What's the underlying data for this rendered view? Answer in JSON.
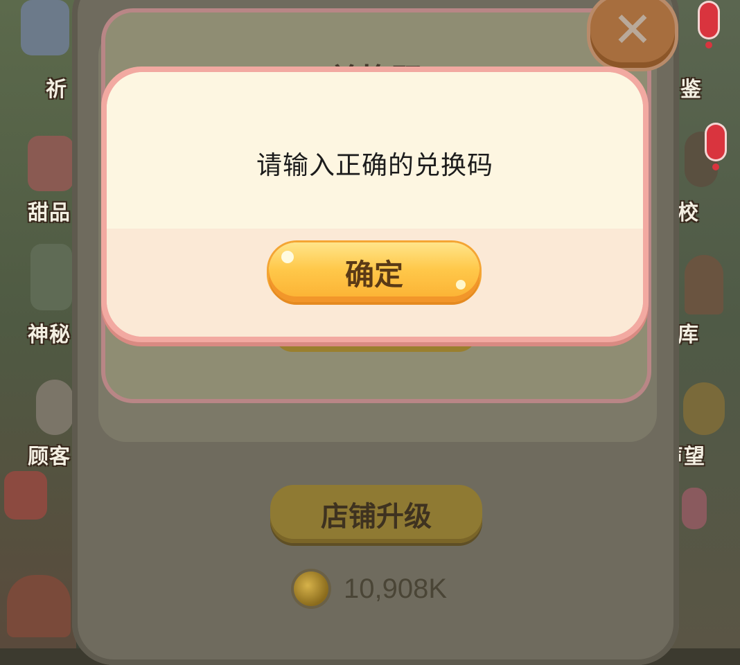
{
  "background": {
    "side_labels_left": [
      "祈",
      "甜品",
      "神秘",
      "顾客"
    ],
    "side_labels_right": [
      "鉴",
      "校",
      "库",
      "声望"
    ]
  },
  "redeem_panel": {
    "title": "兑换码",
    "close_icon": "close-x-icon"
  },
  "shop": {
    "upgrade_label": "店铺升级",
    "coin_icon": "gold-coin-icon",
    "coin_value": "10,908K"
  },
  "dialog": {
    "message": "请输入正确的兑换码",
    "confirm_label": "确定"
  },
  "colors": {
    "dialog_border": "#f2a9a1",
    "dialog_bg": "#fdf6e1",
    "confirm_button": "#ffc84a"
  }
}
